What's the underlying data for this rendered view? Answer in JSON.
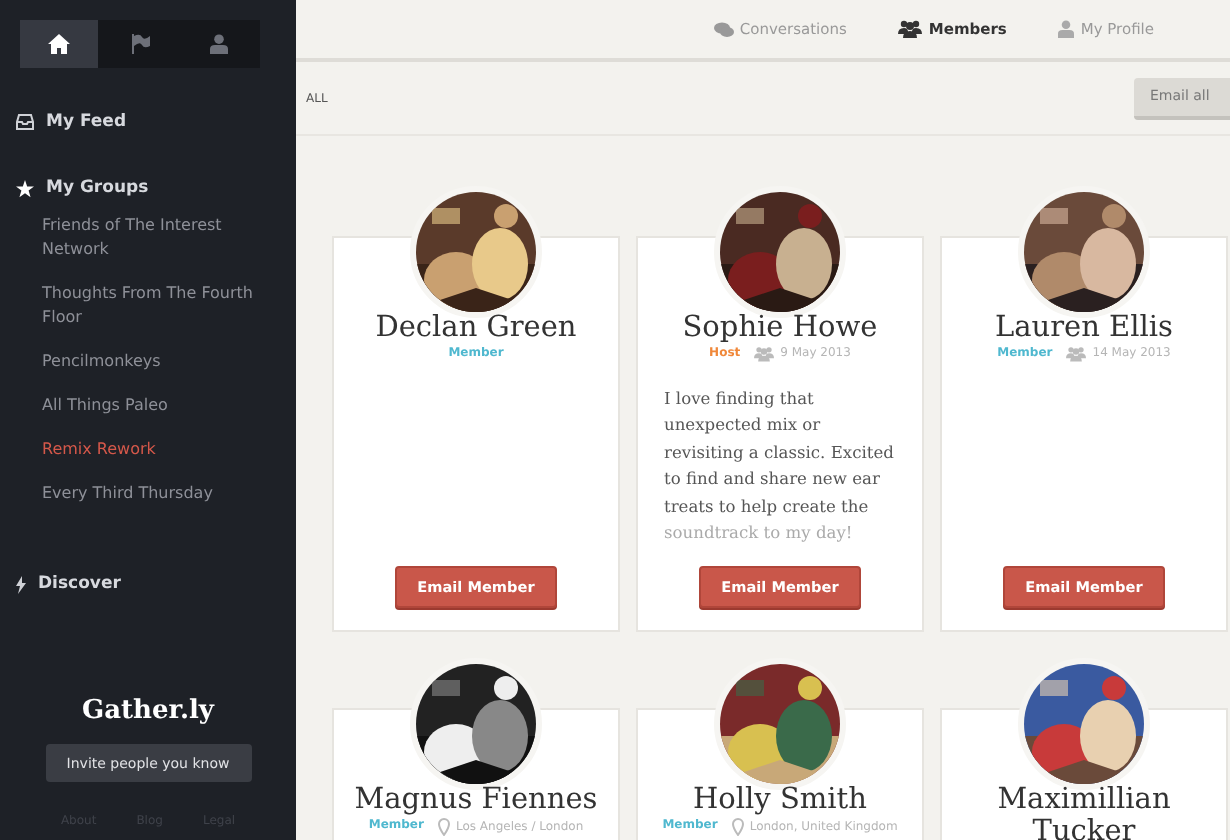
{
  "sidebar": {
    "tabs": [
      {
        "selected": true
      },
      {
        "selected": false
      },
      {
        "selected": false
      }
    ],
    "my_feed": "My Feed",
    "my_groups": "My Groups",
    "groups": [
      {
        "label": "Friends of The Interest Network",
        "selected": false
      },
      {
        "label": "Thoughts From The Fourth Floor",
        "selected": false
      },
      {
        "label": "Pencilmonkeys",
        "selected": false
      },
      {
        "label": "All Things Paleo",
        "selected": false
      },
      {
        "label": "Remix Rework",
        "selected": true
      },
      {
        "label": "Every Third Thursday",
        "selected": false
      }
    ],
    "discover": "Discover",
    "logo": "Gather.ly",
    "invite_button": "Invite people you know",
    "footer_links": [
      "About",
      "Blog",
      "Legal"
    ]
  },
  "top_nav": [
    {
      "label": "Conversations",
      "selected": false
    },
    {
      "label": "Members",
      "selected": true
    },
    {
      "label": "My Profile",
      "selected": false
    }
  ],
  "filter": {
    "label": "ALL",
    "email_all_button": "Email all"
  },
  "members": [
    {
      "name": "Declan Green",
      "role": {
        "label": "Member",
        "color": "#4fb8cf"
      },
      "action": "Email Member"
    },
    {
      "name": "Sophie Howe",
      "role": {
        "label": "Host",
        "color": "#f0883a"
      },
      "joined": "9 May 2013",
      "bio": "I love finding that unexpected mix or revisiting a classic. Excited to find and share new ear treats to help create the",
      "bio_faded": "soundtrack to my day!",
      "action": "Email Member"
    },
    {
      "name": "Lauren Ellis",
      "role": {
        "label": "Member",
        "color": "#4fb8cf"
      },
      "joined": "14 May 2013",
      "action": "Email Member"
    },
    {
      "name": "Magnus Fiennes",
      "role": {
        "label": "Member",
        "color": "#4fb8cf"
      },
      "location": "Los Angeles / London"
    },
    {
      "name": "Holly Smith",
      "role": {
        "label": "Member",
        "color": "#4fb8cf"
      },
      "location": "London, United Kingdom"
    },
    {
      "name": "Maximillian Tucker"
    }
  ]
}
